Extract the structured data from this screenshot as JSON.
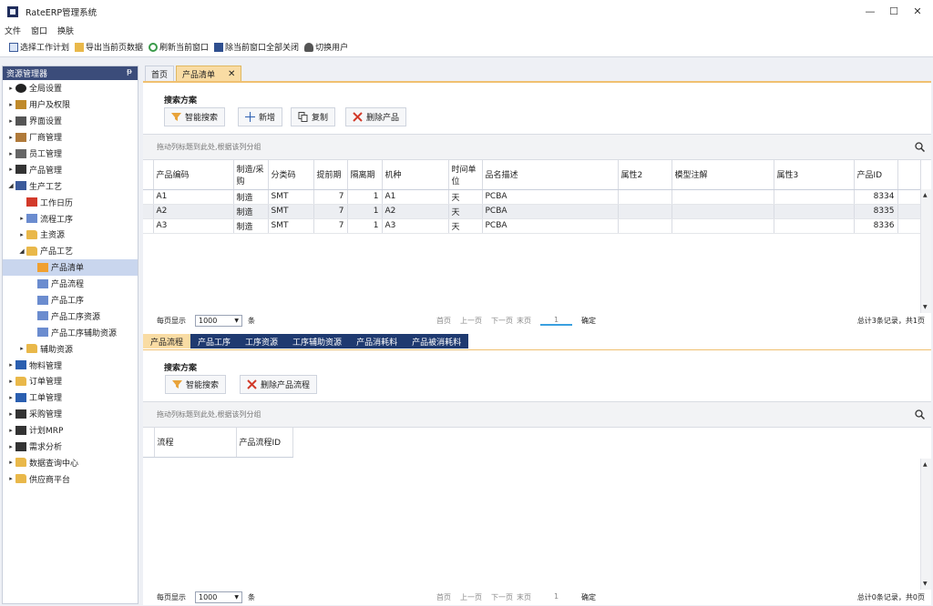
{
  "app": {
    "title": "RateERP管理系统"
  },
  "window_controls": {
    "minimize": "—",
    "maximize": "☐",
    "close": "✕"
  },
  "menu": [
    "文件",
    "窗口",
    "换肤"
  ],
  "toolbar": [
    {
      "label": "选择工作计划",
      "icon": "calendar-list-icon"
    },
    {
      "label": "导出当前页数据",
      "icon": "export-folder-icon"
    },
    {
      "label": "刷新当前窗口",
      "icon": "refresh-icon"
    },
    {
      "label": "除当前窗口全部关闭",
      "icon": "save-disk-icon"
    },
    {
      "label": "切换用户",
      "icon": "user-icon"
    }
  ],
  "explorer": {
    "title": "资源管理器",
    "pin": "ᵽ",
    "nodes": [
      {
        "label": "全局设置",
        "level": 0,
        "arrow": "▸",
        "icon": "gear-icon"
      },
      {
        "label": "用户及权限",
        "level": 0,
        "arrow": "▸",
        "icon": "user-key-icon"
      },
      {
        "label": "界面设置",
        "level": 0,
        "arrow": "▸",
        "icon": "monitor-icon"
      },
      {
        "label": "厂商管理",
        "level": 0,
        "arrow": "▸",
        "icon": "vendor-icon"
      },
      {
        "label": "员工管理",
        "level": 0,
        "arrow": "▸",
        "icon": "employee-icon"
      },
      {
        "label": "产品管理",
        "level": 0,
        "arrow": "▸",
        "icon": "box-icon"
      },
      {
        "label": "生产工艺",
        "level": 0,
        "arrow": "◢",
        "icon": "process-icon"
      },
      {
        "label": "工作日历",
        "level": 1,
        "arrow": "",
        "icon": "calendar-icon"
      },
      {
        "label": "流程工序",
        "level": 1,
        "arrow": "▸",
        "icon": "flow-icon"
      },
      {
        "label": "主资源",
        "level": 1,
        "arrow": "▸",
        "icon": "folder-icon"
      },
      {
        "label": "产品工艺",
        "level": 1,
        "arrow": "◢",
        "icon": "folder-open-icon"
      },
      {
        "label": "产品清单",
        "level": 2,
        "arrow": "",
        "icon": "product-list-icon",
        "selected": true
      },
      {
        "label": "产品流程",
        "level": 2,
        "arrow": "",
        "icon": "flow-icon"
      },
      {
        "label": "产品工序",
        "level": 2,
        "arrow": "",
        "icon": "flow-icon"
      },
      {
        "label": "产品工序资源",
        "level": 2,
        "arrow": "",
        "icon": "flow-icon"
      },
      {
        "label": "产品工序辅助资源",
        "level": 2,
        "arrow": "",
        "icon": "flow-icon"
      },
      {
        "label": "辅助资源",
        "level": 1,
        "arrow": "▸",
        "icon": "folder-icon"
      },
      {
        "label": "物料管理",
        "level": 0,
        "arrow": "▸",
        "icon": "material-icon"
      },
      {
        "label": "订单管理",
        "level": 0,
        "arrow": "▸",
        "icon": "folder-icon"
      },
      {
        "label": "工单管理",
        "level": 0,
        "arrow": "▸",
        "icon": "list-icon"
      },
      {
        "label": "采购管理",
        "level": 0,
        "arrow": "▸",
        "icon": "cart-icon"
      },
      {
        "label": "计划MRP",
        "level": 0,
        "arrow": "▸",
        "icon": "plan-icon"
      },
      {
        "label": "需求分析",
        "level": 0,
        "arrow": "▸",
        "icon": "chart-board-icon"
      },
      {
        "label": "数据查询中心",
        "level": 0,
        "arrow": "▸",
        "icon": "folder-icon"
      },
      {
        "label": "供应商平台",
        "level": 0,
        "arrow": "▸",
        "icon": "folder-icon"
      }
    ]
  },
  "tabs": [
    {
      "label": "首页"
    },
    {
      "label": "产品清单",
      "close": "✕"
    }
  ],
  "top": {
    "search_title": "搜索方案",
    "buttons": [
      {
        "label": "智能搜索",
        "icon": "funnel-icon"
      },
      {
        "label": "新增",
        "icon": "plus-icon"
      },
      {
        "label": "复制",
        "icon": "copy-icon"
      },
      {
        "label": "删除产品",
        "icon": "delete-x-icon"
      }
    ],
    "group_hint": "拖动列标题到此处,根据该列分组",
    "columns": [
      "产品编码",
      "制造/采购",
      "分类码",
      "提前期",
      "隔离期",
      "机种",
      "时间单位",
      "品名描述",
      "属性2",
      "模型注解",
      "属性3",
      "产品ID"
    ],
    "rows": [
      [
        "A1",
        "制造",
        "SMT",
        "7",
        "1",
        "A1",
        "天",
        "PCBA",
        "",
        "",
        "",
        "8334"
      ],
      [
        "A2",
        "制造",
        "SMT",
        "7",
        "1",
        "A2",
        "天",
        "PCBA",
        "",
        "",
        "",
        "8335"
      ],
      [
        "A3",
        "制造",
        "SMT",
        "7",
        "1",
        "A3",
        "天",
        "PCBA",
        "",
        "",
        "",
        "8336"
      ]
    ],
    "pager": {
      "per_page_label": "每页显示",
      "per_page": "1000",
      "unit": "条",
      "first": "首页",
      "prev": "上一页",
      "next": "下一页",
      "last": "末页",
      "page": "1",
      "ok": "确定",
      "summary": "总计3条记录，共1页"
    }
  },
  "subtabs": [
    {
      "label": "产品流程",
      "active": true
    },
    {
      "label": "产品工序"
    },
    {
      "label": "工序资源"
    },
    {
      "label": "工序辅助资源"
    },
    {
      "label": "产品消耗料"
    },
    {
      "label": "产品被消耗料"
    }
  ],
  "bottom": {
    "search_title": "搜索方案",
    "buttons": [
      {
        "label": "智能搜索",
        "icon": "funnel-icon"
      },
      {
        "label": "删除产品流程",
        "icon": "delete-x-icon"
      }
    ],
    "group_hint": "拖动列标题到此处,根据该列分组",
    "columns": [
      "流程",
      "产品流程ID"
    ],
    "pager": {
      "per_page_label": "每页显示",
      "per_page": "1000",
      "unit": "条",
      "first": "首页",
      "prev": "上一页",
      "next": "下一页",
      "last": "末页",
      "page": "1",
      "ok": "确定",
      "summary": "总计0条记录，共0页"
    }
  },
  "colors": {
    "accent": "#f9dca4",
    "nav_dark": "#1f3a70",
    "header": "#3b4c7a",
    "selection": "#c9d6ee"
  }
}
